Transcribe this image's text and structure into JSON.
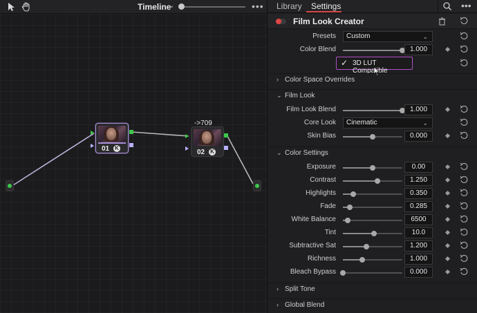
{
  "node_editor": {
    "title": "Timeline",
    "chevron": "⌄",
    "more": "•••",
    "zoom_level": 0.0,
    "nodes": [
      {
        "number": "01",
        "fx": "K"
      },
      {
        "number": "02",
        "fx": "K"
      }
    ],
    "output_label": "->709"
  },
  "tabs": {
    "library": "Library",
    "settings": "Settings",
    "more": "•••"
  },
  "effect": {
    "title": "Film Look Creator",
    "enabled": true,
    "accent_color": "#e04444"
  },
  "presets": {
    "label": "Presets",
    "value": "Custom"
  },
  "color_blend": {
    "label": "Color Blend",
    "value": "1.000",
    "fraction": 1.0
  },
  "lut": {
    "label": "3D LUT Compatible",
    "checked": true,
    "check_glyph": "✓"
  },
  "sections": {
    "color_space_overrides": {
      "title": "Color Space Overrides",
      "expanded": false
    },
    "film_look": {
      "title": "Film Look",
      "expanded": true
    },
    "color_settings": {
      "title": "Color Settings",
      "expanded": true
    },
    "split_tone": {
      "title": "Split Tone",
      "expanded": false
    },
    "global_blend": {
      "title": "Global Blend",
      "expanded": false
    }
  },
  "arrows": {
    "collapsed": "›",
    "expanded": "⌄"
  },
  "film_look": {
    "blend": {
      "label": "Film Look Blend",
      "value": "1.000",
      "fraction": 1.0
    },
    "core_look": {
      "label": "Core Look",
      "value": "Cinematic"
    },
    "skin_bias": {
      "label": "Skin Bias",
      "value": "0.000",
      "fraction": 0.5
    }
  },
  "color_settings": [
    {
      "label": "Exposure",
      "value": "0.00",
      "fraction": 0.5
    },
    {
      "label": "Contrast",
      "value": "1.250",
      "fraction": 0.58
    },
    {
      "label": "Highlights",
      "value": "0.350",
      "fraction": 0.17
    },
    {
      "label": "Fade",
      "value": "0.285",
      "fraction": 0.12
    },
    {
      "label": "White Balance",
      "value": "6500",
      "fraction": 0.08
    },
    {
      "label": "Tint",
      "value": "10.0",
      "fraction": 0.52
    },
    {
      "label": "Subtractive Sat",
      "value": "1.200",
      "fraction": 0.4
    },
    {
      "label": "Richness",
      "value": "1.000",
      "fraction": 0.32
    },
    {
      "label": "Bleach Bypass",
      "value": "0.000",
      "fraction": 0.0
    }
  ]
}
